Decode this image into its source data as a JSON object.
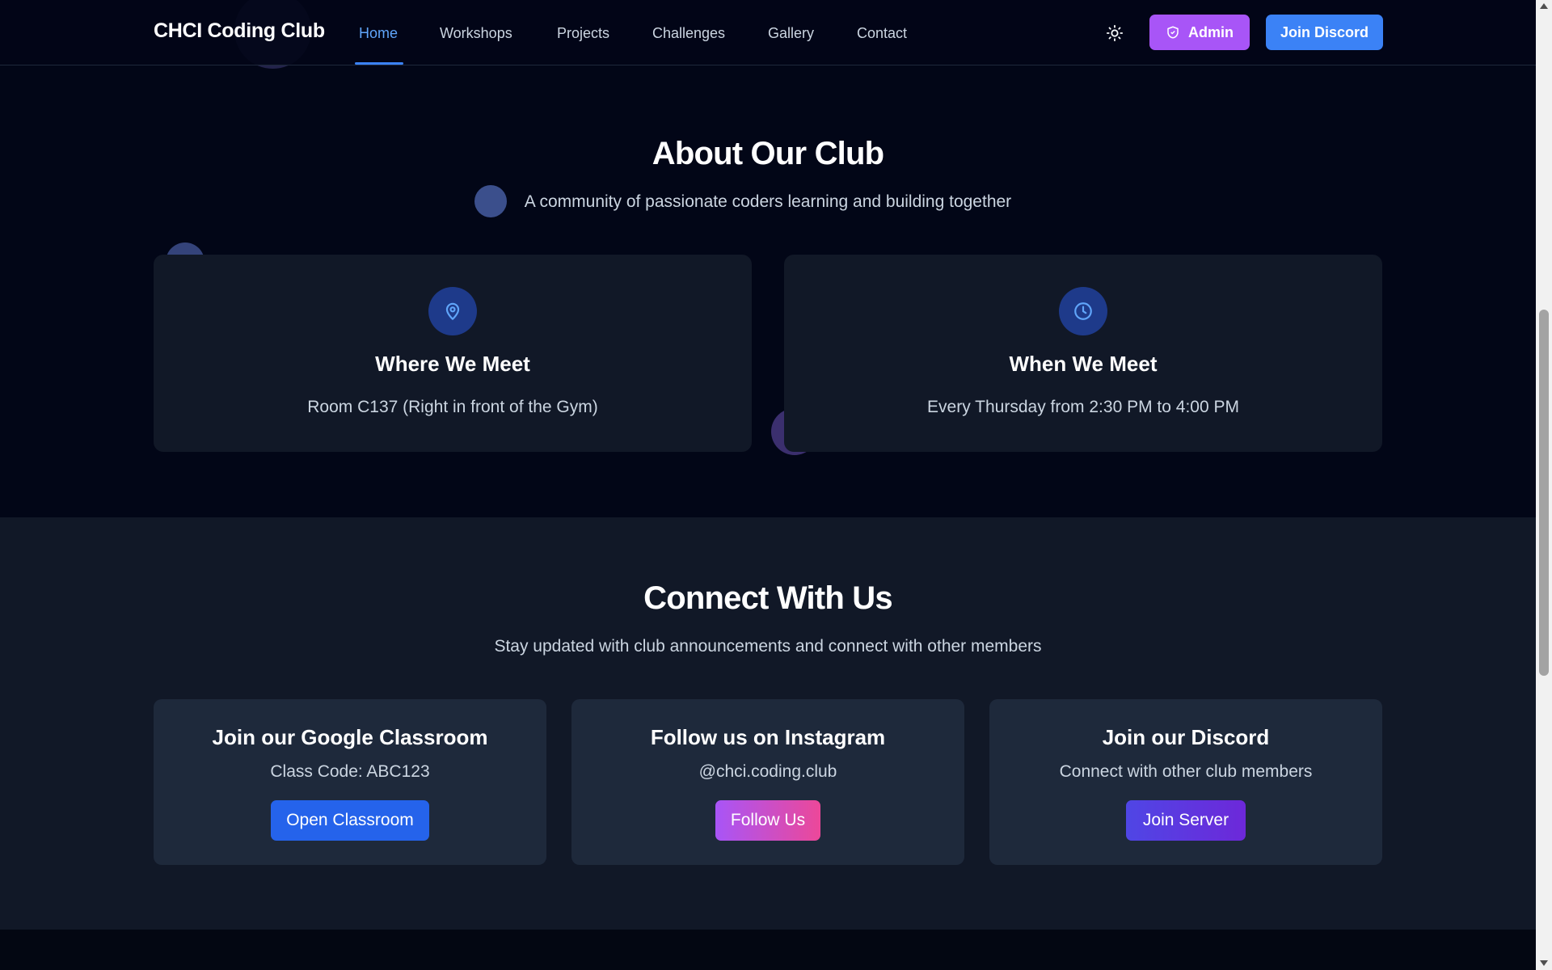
{
  "nav": {
    "brand": "CHCI Coding Club",
    "links": [
      {
        "label": "Home",
        "active": true
      },
      {
        "label": "Workshops"
      },
      {
        "label": "Projects"
      },
      {
        "label": "Challenges"
      },
      {
        "label": "Gallery"
      },
      {
        "label": "Contact"
      }
    ],
    "theme_icon": "sun-icon",
    "admin_label": "Admin",
    "admin_icon": "shield-icon",
    "discord_label": "Join Discord"
  },
  "about": {
    "title": "About Our Club",
    "subtitle": "A community of passionate coders learning and building together",
    "cards": [
      {
        "icon": "map-pin-icon",
        "title": "Where We Meet",
        "text": "Room C137 (Right in front of the Gym)"
      },
      {
        "icon": "clock-icon",
        "title": "When We Meet",
        "text": "Every Thursday from 2:30 PM to 4:00 PM"
      }
    ]
  },
  "connect": {
    "title": "Connect With Us",
    "subtitle": "Stay updated with club announcements and connect with other members",
    "cards": [
      {
        "title": "Join our Google Classroom",
        "text": "Class Code: ABC123",
        "button": "Open Classroom",
        "color": "#2563eb"
      },
      {
        "title": "Follow us on Instagram",
        "text": "@chci.coding.club",
        "button": "Follow Us",
        "color": "#ec4899"
      },
      {
        "title": "Join our Discord",
        "text": "Connect with other club members",
        "button": "Join Server",
        "color": "#4f46e5"
      }
    ]
  },
  "colors": {
    "accent": "#3b82f6",
    "admin": "#a855f7",
    "background": "#020617",
    "card": "#111827"
  }
}
